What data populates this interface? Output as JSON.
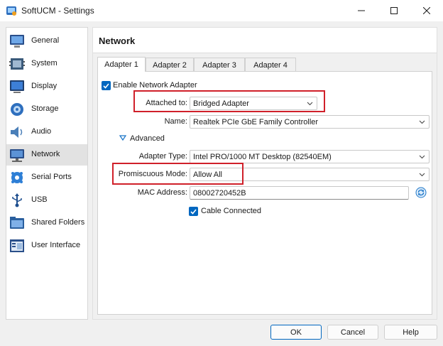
{
  "window": {
    "title": "SoftUCM - Settings",
    "controls": [
      "minimize-icon",
      "maximize-icon",
      "close-icon"
    ]
  },
  "sidebar": {
    "items": [
      {
        "label": "General",
        "icon": "general-icon",
        "active": false
      },
      {
        "label": "System",
        "icon": "system-icon",
        "active": false
      },
      {
        "label": "Display",
        "icon": "display-icon",
        "active": false
      },
      {
        "label": "Storage",
        "icon": "storage-icon",
        "active": false
      },
      {
        "label": "Audio",
        "icon": "audio-icon",
        "active": false
      },
      {
        "label": "Network",
        "icon": "network-icon",
        "active": true
      },
      {
        "label": "Serial Ports",
        "icon": "serial-ports-icon",
        "active": false
      },
      {
        "label": "USB",
        "icon": "usb-icon",
        "active": false
      },
      {
        "label": "Shared Folders",
        "icon": "shared-folders-icon",
        "active": false
      },
      {
        "label": "User Interface",
        "icon": "user-interface-icon",
        "active": false
      }
    ]
  },
  "page": {
    "title": "Network"
  },
  "tabs": [
    {
      "label": "Adapter 1",
      "active": true
    },
    {
      "label": "Adapter 2",
      "active": false
    },
    {
      "label": "Adapter 3",
      "active": false
    },
    {
      "label": "Adapter 4",
      "active": false
    }
  ],
  "adapter": {
    "enable_label": "Enable Network Adapter",
    "enable_checked": true,
    "attached_label": "Attached to:",
    "attached_value": "Bridged Adapter",
    "name_label": "Name:",
    "name_value": "Realtek PCIe GbE Family Controller",
    "advanced_label": "Advanced",
    "adapter_type_label": "Adapter Type:",
    "adapter_type_value": "Intel PRO/1000 MT Desktop (82540EM)",
    "promiscuous_label": "Promiscuous Mode:",
    "promiscuous_value": "Allow All",
    "mac_label": "MAC Address:",
    "mac_value": "08002720452B",
    "cable_label": "Cable Connected",
    "cable_checked": true
  },
  "buttons": {
    "ok": "OK",
    "cancel": "Cancel",
    "help": "Help"
  },
  "colors": {
    "accent": "#0067c0",
    "highlight": "#d0202a"
  }
}
